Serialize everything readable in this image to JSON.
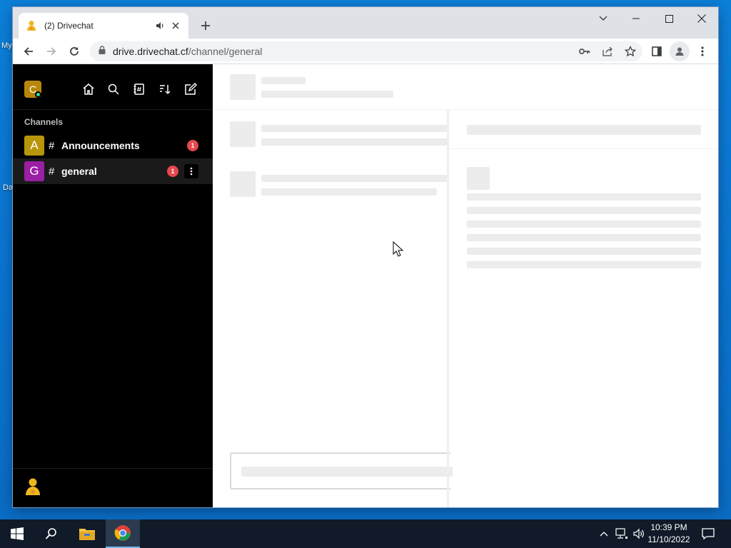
{
  "desktop": {
    "fragments": [
      "My",
      "Da"
    ]
  },
  "browser": {
    "tab_title": "(2) Drivechat",
    "url_host": "drive.drivechat.cf",
    "url_path": "/channel/general"
  },
  "sidebar": {
    "workspace_initial": "C",
    "section_label": "Channels",
    "rooms": [
      {
        "avatar": "A",
        "avatar_color": "#b8960b",
        "hash": "#",
        "name": "Announcements",
        "unread": "1"
      },
      {
        "avatar": "G",
        "avatar_color": "#9b1fa5",
        "hash": "#",
        "name": "general",
        "unread": "1"
      }
    ]
  },
  "taskbar": {
    "time": "10:39 PM",
    "date": "11/10/2022"
  },
  "colors": {
    "desktop_blue": "#0a78d7",
    "sidebar_bg": "#000000",
    "badge_red": "#e5484d",
    "status_green": "#2de0a5"
  }
}
